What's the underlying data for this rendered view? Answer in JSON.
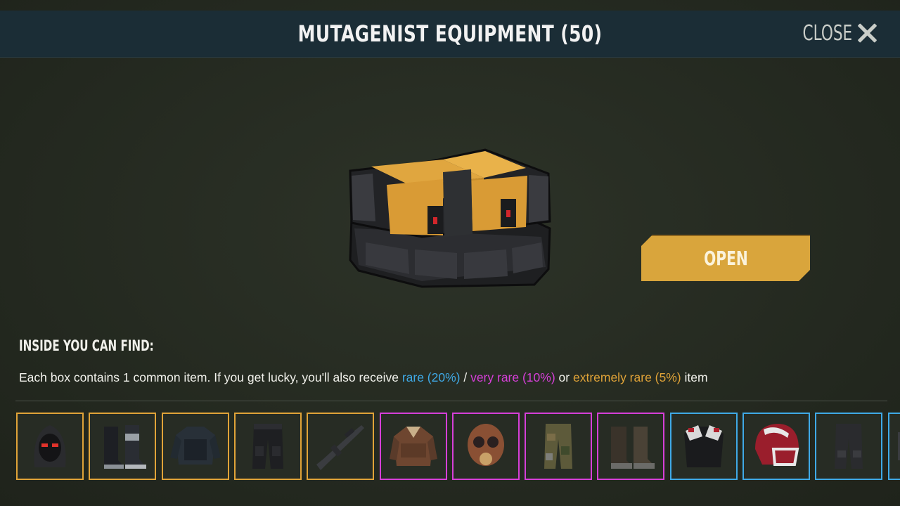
{
  "header": {
    "title": "MUTAGENIST EQUIPMENT (50)",
    "close_label": "CLOSE"
  },
  "chest": {
    "icon": "equipment-crate-icon"
  },
  "open_button": {
    "label": "OPEN"
  },
  "info": {
    "heading": "INSIDE YOU CAN FIND:",
    "description_prefix": "Each box contains 1 common item. If you get lucky, you'll also receive ",
    "rare_text": "rare (20%)",
    "sep1": " / ",
    "very_rare_text": "very rare (10%)",
    "sep2": " or ",
    "extremely_rare_text": "extremely rare (5%)",
    "suffix": " item"
  },
  "colors": {
    "rare": "#3fa9e6",
    "very_rare": "#d63fd8",
    "extremely_rare": "#e0a338",
    "button": "#d9a53c",
    "header_bar": "#1b2d36"
  },
  "items": [
    {
      "icon": "hooded-mask-icon",
      "rarity": "extremely_rare"
    },
    {
      "icon": "boots-icon",
      "rarity": "extremely_rare"
    },
    {
      "icon": "armored-jacket-icon",
      "rarity": "extremely_rare"
    },
    {
      "icon": "tactical-pants-icon",
      "rarity": "extremely_rare"
    },
    {
      "icon": "rifle-icon",
      "rarity": "extremely_rare"
    },
    {
      "icon": "leather-jacket-icon",
      "rarity": "very_rare"
    },
    {
      "icon": "gas-mask-icon",
      "rarity": "very_rare"
    },
    {
      "icon": "camo-pants-icon",
      "rarity": "very_rare"
    },
    {
      "icon": "combat-boots-icon",
      "rarity": "very_rare"
    },
    {
      "icon": "football-pads-icon",
      "rarity": "rare"
    },
    {
      "icon": "football-helmet-icon",
      "rarity": "rare"
    },
    {
      "icon": "dark-pants-icon",
      "rarity": "rare"
    },
    {
      "icon": "partial-item-icon",
      "rarity": "rare"
    }
  ]
}
